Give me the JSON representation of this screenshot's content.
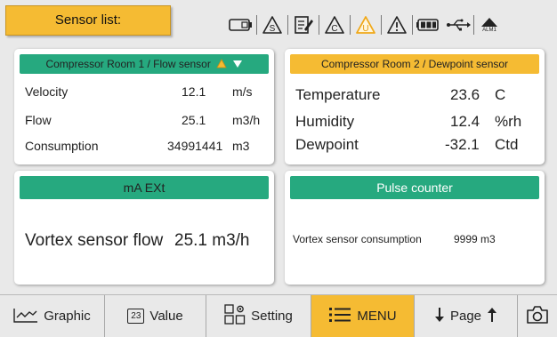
{
  "topbar": {
    "sensor_list_label": "Sensor list:",
    "status_icons": [
      "card-reader-icon",
      "warning-s-icon",
      "document-edit-icon",
      "warning-c-icon",
      "warning-u-active-icon",
      "warning-icon",
      "battery-icon",
      "usb-icon",
      "alarm-icon"
    ],
    "alarm_label": "ALM1"
  },
  "panels": {
    "flow": {
      "title": "Compressor Room 1 / Flow sensor",
      "rows": [
        {
          "label": "Velocity",
          "value": "12.1",
          "unit": "m/s"
        },
        {
          "label": "Flow",
          "value": "25.1",
          "unit": "m3/h"
        },
        {
          "label": "Consumption",
          "value": "34991441",
          "unit": "m3"
        }
      ]
    },
    "dewpoint": {
      "title": "Compressor Room 2 / Dewpoint sensor",
      "rows": [
        {
          "label": "Temperature",
          "value": "23.6",
          "unit": "C"
        },
        {
          "label": "Humidity",
          "value": "12.4",
          "unit": "%rh"
        },
        {
          "label": "Dewpoint",
          "value": "-32.1",
          "unit": "Ctd"
        }
      ]
    },
    "ma_ext": {
      "title": "mA EXt",
      "label": "Vortex sensor flow",
      "value": "25.1 m3/h"
    },
    "pulse": {
      "title": "Pulse counter",
      "label": "Vortex sensor consumption",
      "value": "9999 m3"
    }
  },
  "bottombar": {
    "graphic_label": "Graphic",
    "value_label": "Value",
    "value_icon_text": "23",
    "setting_label": "Setting",
    "menu_label": "MENU",
    "page_label": "Page"
  },
  "colors": {
    "accent_amber": "#f5bb33",
    "header_green": "#26a97f",
    "background": "#e9e9e9"
  }
}
